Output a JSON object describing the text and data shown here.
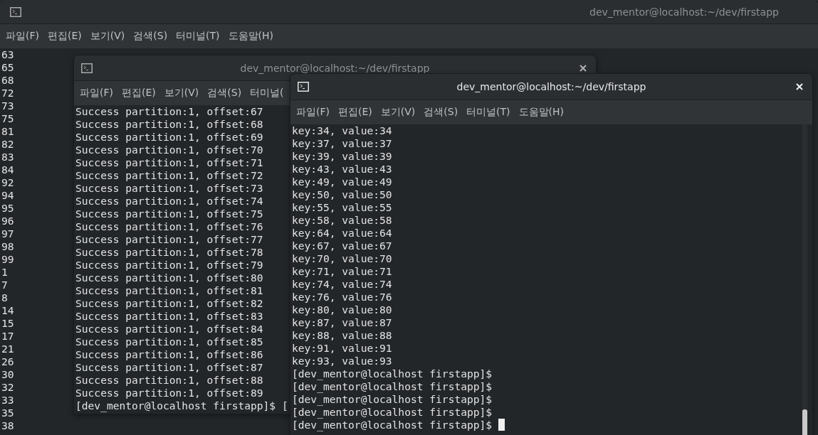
{
  "windows": [
    {
      "title": "dev_mentor@localhost:~/dev/firstapp",
      "focused": false,
      "close_button": false,
      "cursor": false,
      "scrollbar": false,
      "menu": [
        "파일(F)",
        "편집(E)",
        "보기(V)",
        "검색(S)",
        "터미널(T)",
        "도움말(H)"
      ],
      "lines": [
        "63",
        "65",
        "68",
        "72",
        "73",
        "75",
        "81",
        "82",
        "83",
        "84",
        "92",
        "94",
        "95",
        "96",
        "97",
        "98",
        "99",
        "1",
        "7",
        "8",
        "14",
        "15",
        "17",
        "21",
        "26",
        "30",
        "32",
        "33",
        "35",
        "38"
      ]
    },
    {
      "title": "dev_mentor@localhost:~/dev/firstapp",
      "focused": false,
      "close_button": true,
      "cursor": false,
      "scrollbar": false,
      "menu": [
        "파일(F)",
        "편집(E)",
        "보기(V)",
        "검색(S)",
        "터미널("
      ],
      "lines": [
        "Success partition:1, offset:67",
        "Success partition:1, offset:68",
        "Success partition:1, offset:69",
        "Success partition:1, offset:70",
        "Success partition:1, offset:71",
        "Success partition:1, offset:72",
        "Success partition:1, offset:73",
        "Success partition:1, offset:74",
        "Success partition:1, offset:75",
        "Success partition:1, offset:76",
        "Success partition:1, offset:77",
        "Success partition:1, offset:78",
        "Success partition:1, offset:79",
        "Success partition:1, offset:80",
        "Success partition:1, offset:81",
        "Success partition:1, offset:82",
        "Success partition:1, offset:83",
        "Success partition:1, offset:84",
        "Success partition:1, offset:85",
        "Success partition:1, offset:86",
        "Success partition:1, offset:87",
        "Success partition:1, offset:88",
        "Success partition:1, offset:89",
        "[dev_mentor@localhost firstapp]$ ["
      ]
    },
    {
      "title": "dev_mentor@localhost:~/dev/firstapp",
      "focused": true,
      "close_button": true,
      "cursor": true,
      "scrollbar": true,
      "menu": [
        "파일(F)",
        "편집(E)",
        "보기(V)",
        "검색(S)",
        "터미널(T)",
        "도움말(H)"
      ],
      "lines": [
        "key:34, value:34",
        "key:37, value:37",
        "key:39, value:39",
        "key:43, value:43",
        "key:49, value:49",
        "key:50, value:50",
        "key:55, value:55",
        "key:58, value:58",
        "key:64, value:64",
        "key:67, value:67",
        "key:70, value:70",
        "key:71, value:71",
        "key:74, value:74",
        "key:76, value:76",
        "key:80, value:80",
        "key:87, value:87",
        "key:88, value:88",
        "key:91, value:91",
        "key:93, value:93",
        "[dev_mentor@localhost firstapp]$",
        "[dev_mentor@localhost firstapp]$",
        "[dev_mentor@localhost firstapp]$",
        "[dev_mentor@localhost firstapp]$",
        "[dev_mentor@localhost firstapp]$"
      ]
    }
  ]
}
